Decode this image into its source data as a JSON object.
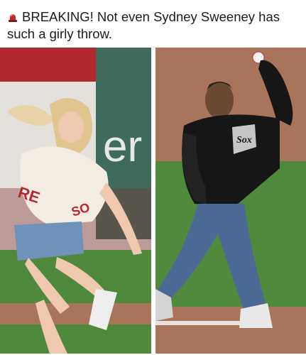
{
  "post": {
    "caption_icon": "police-siren-emoji",
    "caption_text": "BREAKING! Not even Sydney Sweeney has such a girly throw."
  },
  "images": {
    "left": {
      "jersey_letters_1": "RE",
      "jersey_letters_2": "SO",
      "wall_text": "er"
    },
    "right": {
      "jersey_logo": "Sox"
    }
  },
  "colors": {
    "siren": "#c62828",
    "grass": "#4f8a3c",
    "dirt": "#a8745a",
    "jacket": "#161616",
    "jeans": "#4a6a95",
    "wall_red": "#b3292d",
    "wall_green": "#3e6b5b"
  }
}
